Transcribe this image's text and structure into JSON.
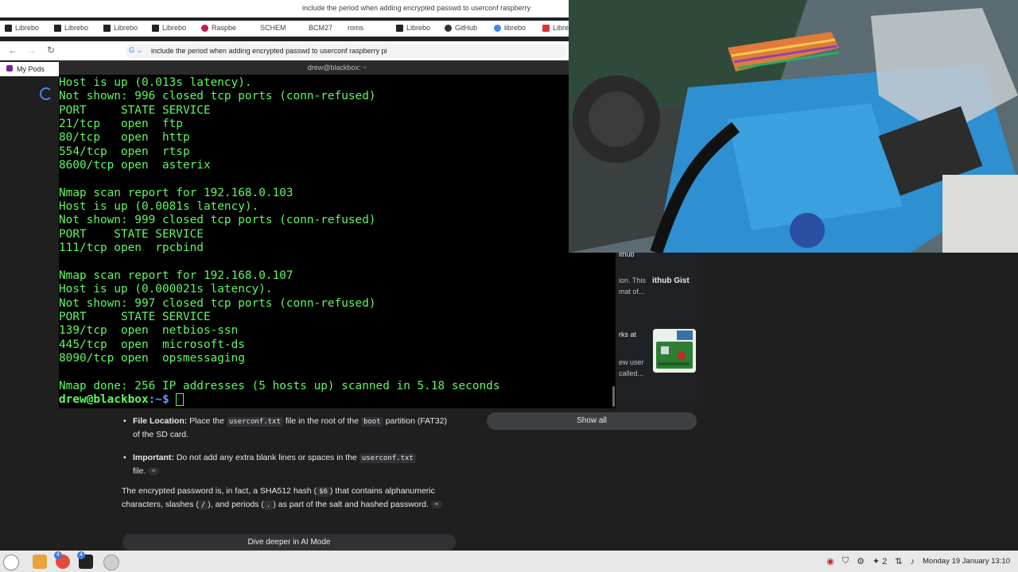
{
  "browser": {
    "window_title": "include the period when adding encrypted passwd to userconf raspberry",
    "bookmarks": [
      "Librebo",
      "Librebo",
      "Librebo",
      "Librebo",
      "Raspbe",
      "SCHEM",
      "BCM27",
      "roms",
      "Librebo",
      "GitHub",
      "librebo",
      "Libre"
    ],
    "omnibox_text": "include the period when adding encrypted passwd to userconf raspberry pi",
    "mypods_label": "My Pods"
  },
  "terminal": {
    "title": "drew@blackbox: ~",
    "lines": [
      "Host is up (0.013s latency).",
      "Not shown: 996 closed tcp ports (conn-refused)",
      "PORT     STATE SERVICE",
      "21/tcp   open  ftp",
      "80/tcp   open  http",
      "554/tcp  open  rtsp",
      "8600/tcp open  asterix",
      "",
      "Nmap scan report for 192.168.0.103",
      "Host is up (0.0081s latency).",
      "Not shown: 999 closed tcp ports (conn-refused)",
      "PORT    STATE SERVICE",
      "111/tcp open  rpcbind",
      "",
      "Nmap scan report for 192.168.0.107",
      "Host is up (0.000021s latency).",
      "Not shown: 997 closed tcp ports (conn-refused)",
      "PORT     STATE SERVICE",
      "139/tcp  open  netbios-ssn",
      "445/tcp  open  microsoft-ds",
      "8090/tcp open  opsmessaging",
      "",
      "Nmap done: 256 IP addresses (5 hosts up) scanned in 5.18 seconds"
    ],
    "prompt_user": "drew@blackbox",
    "prompt_path": ":~$ "
  },
  "side_results": {
    "r1_line1": "ithub",
    "r1_line2": "ion. This",
    "r1_line3": "mat of...",
    "gist_label": "ithub Gist",
    "r2_line1": "rks at",
    "r2_line2": "ew user",
    "r2_line3": "called...",
    "show_all": "Show all"
  },
  "ai_overview": {
    "b1_label": "File Location:",
    "b1_t1": " Place the ",
    "b1_code": "userconf.txt",
    "b1_t2": " file in the root of the ",
    "b1_code2": "boot",
    "b1_t3": " partition (FAT32) of the SD card.",
    "b2_label": "Important:",
    "b2_t1": " Do not add any extra blank lines or spaces in the ",
    "b2_code": "userconf.txt",
    "b2_t2": " file.",
    "p_t1": "The encrypted password is, in fact, a SHA512 hash (",
    "p_code1": "$6",
    "p_t2": ") that contains alphanumeric characters, slashes (",
    "p_code2": "/",
    "p_t3": "), and periods (",
    "p_code3": ".",
    "p_t4": ") as part of the salt and hashed password.",
    "dive_button": "Dive deeper in AI Mode"
  },
  "taskbar": {
    "badge_count": "4",
    "tray_count": "2",
    "clock": "Monday 19 January 13:10"
  },
  "colors": {
    "terminal_fg": "#5ff75f",
    "terminal_path": "#5c9cff",
    "page_bg": "#1f1f1f"
  }
}
